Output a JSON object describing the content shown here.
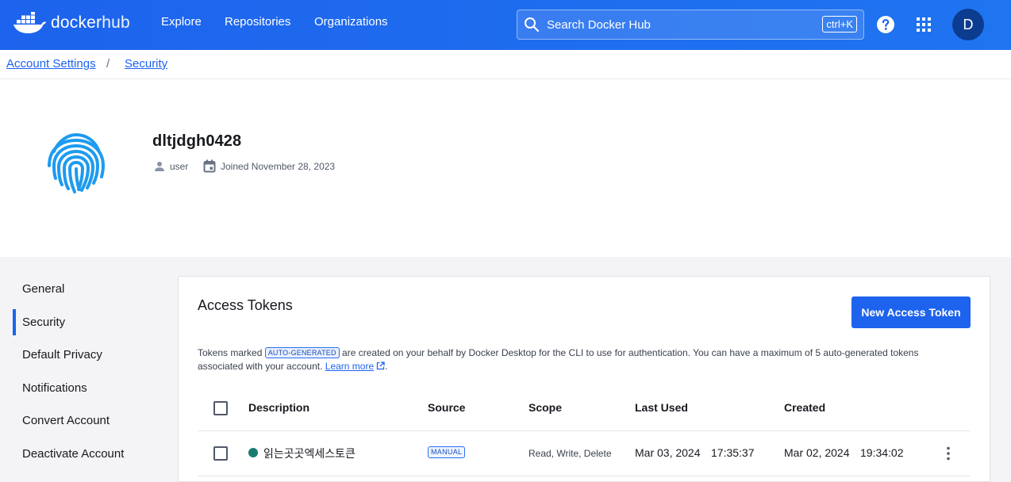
{
  "header": {
    "logo_text_docker": "docker",
    "logo_text_hub": "hub",
    "nav": [
      "Explore",
      "Repositories",
      "Organizations"
    ],
    "search_placeholder": "Search Docker Hub",
    "search_shortcut": "ctrl+K",
    "avatar_initial": "D"
  },
  "breadcrumb": {
    "items": [
      "Account Settings",
      "Security"
    ],
    "separator": "/"
  },
  "profile": {
    "username": "dltjdgh0428",
    "role": "user",
    "joined": "Joined November 28, 2023"
  },
  "sidebar": {
    "items": [
      "General",
      "Security",
      "Default Privacy",
      "Notifications",
      "Convert Account",
      "Deactivate Account"
    ],
    "active": "Security"
  },
  "access_tokens": {
    "title": "Access Tokens",
    "new_button": "New Access Token",
    "info_prefix": "Tokens marked",
    "info_badge": "AUTO-GENERATED",
    "info_middle": "are created on your behalf by Docker Desktop for the CLI to use for authentication. You can have a maximum of 5 auto-generated tokens associated with your account.",
    "learn_more": "Learn more",
    "info_suffix": ".",
    "columns": [
      "Description",
      "Source",
      "Scope",
      "Last Used",
      "Created"
    ],
    "rows": [
      {
        "description": "읽는곳곳엑세스토큰",
        "source": "MANUAL",
        "scope": "Read, Write, Delete",
        "last_used_date": "Mar 03, 2024",
        "last_used_time": "17:35:37",
        "created_date": "Mar 02, 2024",
        "created_time": "19:34:02"
      }
    ]
  },
  "colors": {
    "brand_blue": "#1d63ed",
    "avatar_bg": "#0c3c8f",
    "fingerprint": "#1d9bf0",
    "active_dot": "#1c7b70"
  }
}
